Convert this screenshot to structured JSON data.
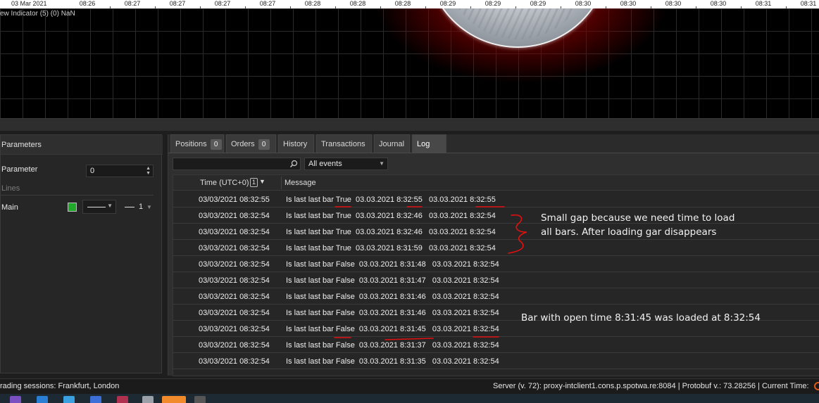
{
  "chart": {
    "date_label": "03 Mar 2021",
    "time_ticks": [
      "08:26",
      "08:27",
      "08:27",
      "08:27",
      "08:27",
      "08:28",
      "08:28",
      "08:28",
      "08:29",
      "08:29",
      "08:29",
      "08:30",
      "08:30",
      "08:30",
      "08:30",
      "08:31",
      "08:31"
    ],
    "indicator_label": "ew Indicator (5) (0) NaN",
    "accent_colors": {
      "glow": "#c81414",
      "orb": "#d8dbe0"
    }
  },
  "params_panel": {
    "title": "Parameters",
    "parameter_label": "Parameter",
    "parameter_value": "0",
    "lines_section": "Lines",
    "main_label": "Main",
    "main_color": "#1fa82a",
    "line_width": "1"
  },
  "tabs": [
    {
      "label": "Positions",
      "count": "0"
    },
    {
      "label": "Orders",
      "count": "0"
    },
    {
      "label": "History"
    },
    {
      "label": "Transactions"
    },
    {
      "label": "Journal"
    },
    {
      "label": "Log",
      "active": true
    }
  ],
  "log": {
    "search_placeholder": "",
    "filter_value": "All events",
    "col_time": "Time (UTC+0)",
    "col_time_badge": "1",
    "col_message": "Message",
    "rows": [
      {
        "time": "03/03/2021 08:32:55",
        "message": "Is last last bar True  03.03.2021 8:32:55   03.03.2021 8:32:55"
      },
      {
        "time": "03/03/2021 08:32:54",
        "message": "Is last last bar True  03.03.2021 8:32:46   03.03.2021 8:32:54"
      },
      {
        "time": "03/03/2021 08:32:54",
        "message": "Is last last bar True  03.03.2021 8:32:46   03.03.2021 8:32:54"
      },
      {
        "time": "03/03/2021 08:32:54",
        "message": "Is last last bar True  03.03.2021 8:31:59   03.03.2021 8:32:54"
      },
      {
        "time": "03/03/2021 08:32:54",
        "message": "Is last last bar False  03.03.2021 8:31:48   03.03.2021 8:32:54"
      },
      {
        "time": "03/03/2021 08:32:54",
        "message": "Is last last bar False  03.03.2021 8:31:47   03.03.2021 8:32:54"
      },
      {
        "time": "03/03/2021 08:32:54",
        "message": "Is last last bar False  03.03.2021 8:31:46   03.03.2021 8:32:54"
      },
      {
        "time": "03/03/2021 08:32:54",
        "message": "Is last last bar False  03.03.2021 8:31:46   03.03.2021 8:32:54"
      },
      {
        "time": "03/03/2021 08:32:54",
        "message": "Is last last bar False  03.03.2021 8:31:45   03.03.2021 8:32:54"
      },
      {
        "time": "03/03/2021 08:32:54",
        "message": "Is last last bar False  03.03.2021 8:31:37   03.03.2021 8:32:54"
      },
      {
        "time": "03/03/2021 08:32:54",
        "message": "Is last last bar False  03.03.2021 8:31:35   03.03.2021 8:32:54"
      }
    ]
  },
  "annotations": {
    "gap_line1": "Small gap because we need time to load",
    "gap_line2": "all bars. After loading gar disappears",
    "bar_note": "Bar with open time 8:31:45 was loaded at 8:32:54",
    "ink_color": "#e01010"
  },
  "statusbar": {
    "left": "rading sessions: Frankfurt, London",
    "right": "Server (v. 72): proxy-intclient1.cons.p.spotwa.re:8084  |  Protobuf v.: 73.28256  |  Current Time:"
  }
}
